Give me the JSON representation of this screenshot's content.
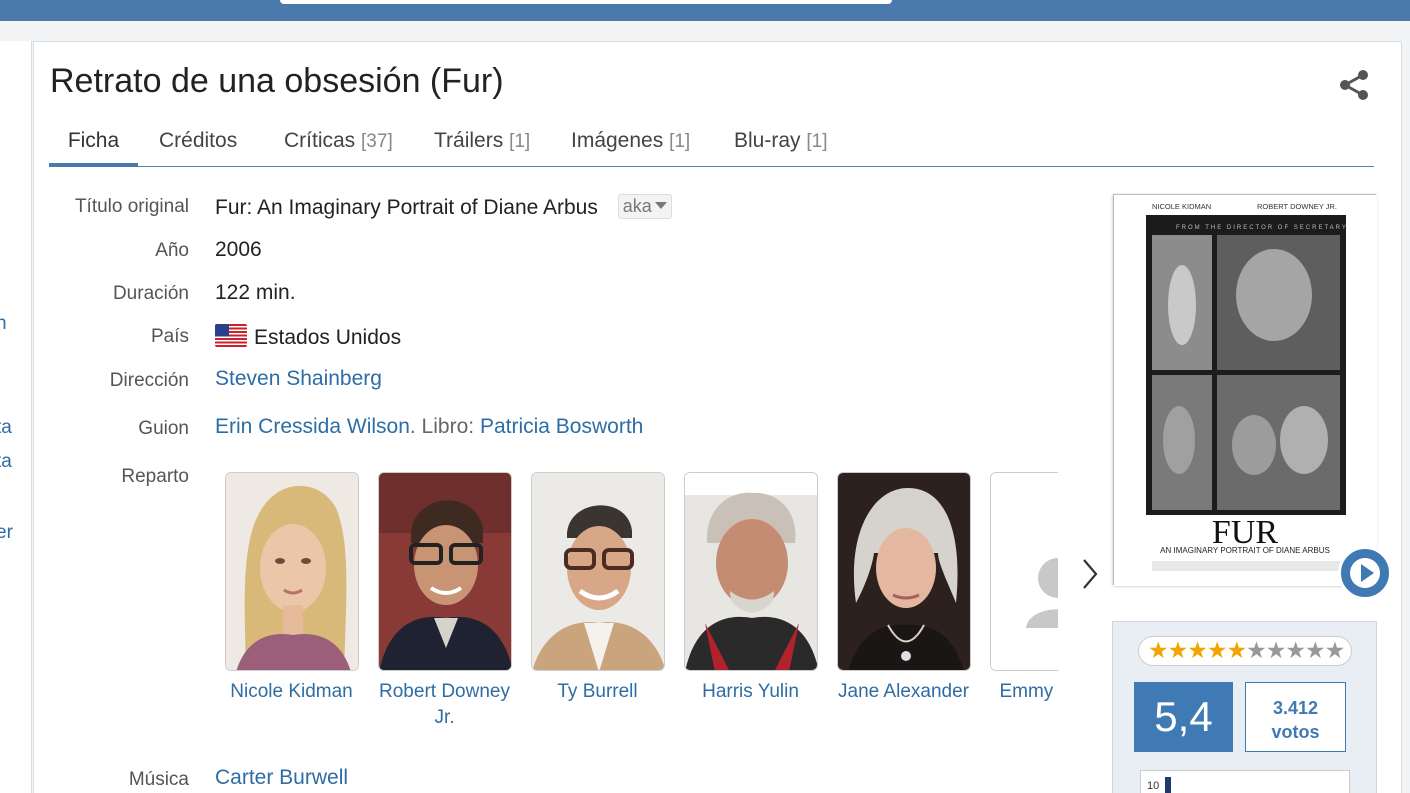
{
  "header": {
    "title": "Retrato de una obsesión (Fur)"
  },
  "tabs": [
    {
      "label": "Ficha",
      "count": ""
    },
    {
      "label": "Créditos",
      "count": ""
    },
    {
      "label": "Críticas",
      "count": "[37]"
    },
    {
      "label": "Tráilers",
      "count": "[1]"
    },
    {
      "label": "Imágenes",
      "count": "[1]"
    },
    {
      "label": "Blu-ray",
      "count": "[1]"
    }
  ],
  "left_fragments": [
    "n",
    "ta",
    "ta",
    "er"
  ],
  "details": {
    "original_title": {
      "label": "Título original",
      "value": "Fur: An Imaginary Portrait of Diane Arbus",
      "aka": "aka"
    },
    "year": {
      "label": "Año",
      "value": "2006"
    },
    "duration": {
      "label": "Duración",
      "value": "122 min."
    },
    "country": {
      "label": "País",
      "value": "Estados Unidos"
    },
    "direction": {
      "label": "Dirección",
      "value": "Steven Shainberg"
    },
    "script": {
      "label": "Guion",
      "writer": "Erin Cressida Wilson",
      "sep": ". Libro: ",
      "book_author": "Patricia Bosworth"
    },
    "cast": {
      "label": "Reparto"
    },
    "music": {
      "label": "Música",
      "value": "Carter Burwell"
    }
  },
  "cast": [
    {
      "name": "Nicole Kidman"
    },
    {
      "name": "Robert Downey Jr."
    },
    {
      "name": "Ty Burrell"
    },
    {
      "name": "Harris Yulin"
    },
    {
      "name": "Jane Alexander"
    },
    {
      "name": "Emmy Clarke"
    }
  ],
  "poster": {
    "actor_left": "NICOLE KIDMAN",
    "actor_right": "ROBERT DOWNEY JR.",
    "tagline": "FROM THE DIRECTOR OF SECRETARY",
    "title": "FUR",
    "subtitle": "AN IMAGINARY PORTRAIT OF DIANE ARBUS"
  },
  "rating": {
    "stars_filled": 5.4,
    "stars_total": 10,
    "score": "5,4",
    "votes_count": "3.412",
    "votes_label": "votos"
  },
  "colors": {
    "topbar": "#4a7aab",
    "accent": "#3f7ab5",
    "link": "#2e6da4"
  }
}
